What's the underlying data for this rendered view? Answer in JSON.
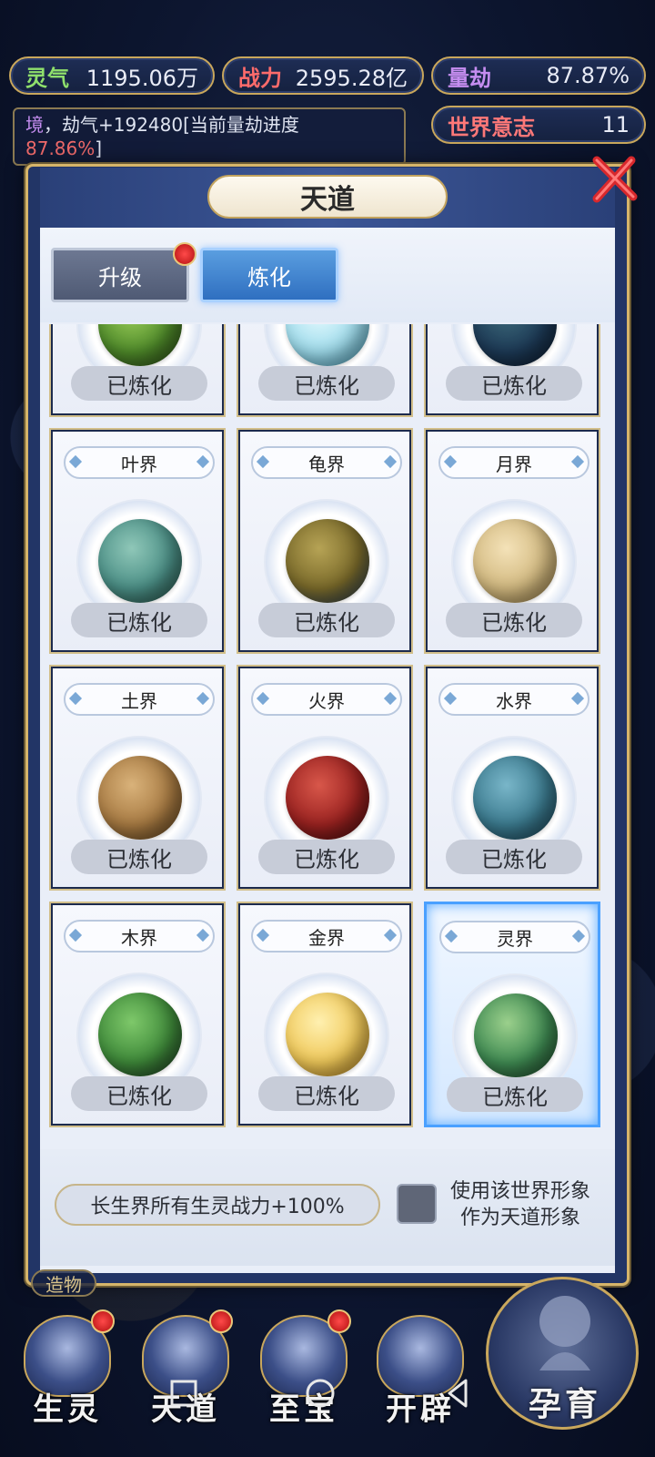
{
  "resources": {
    "lingqi": {
      "label": "灵气",
      "value": "1195.06万"
    },
    "zhanli": {
      "label": "战力",
      "value": "2595.28亿"
    },
    "liangjie": {
      "label": "量劫",
      "value": "87.87%"
    },
    "shijie": {
      "label": "世界意志",
      "value": "11"
    }
  },
  "notice": {
    "prefix": "境",
    "text": "，劫气+192480[当前量劫进度",
    "percent": "87.86%",
    "suffix": "]"
  },
  "dialog": {
    "title": "天道",
    "tabs": [
      {
        "label": "升级",
        "active": false
      },
      {
        "label": "炼化",
        "active": true
      }
    ]
  },
  "worlds": [
    {
      "name": "",
      "status": "已炼化",
      "planet": "green-woven"
    },
    {
      "name": "",
      "status": "已炼化",
      "planet": "ice-crystal"
    },
    {
      "name": "",
      "status": "已炼化",
      "planet": "dark-ocean"
    },
    {
      "name": "叶界",
      "status": "已炼化",
      "planet": "leaf"
    },
    {
      "name": "龟界",
      "status": "已炼化",
      "planet": "turtle"
    },
    {
      "name": "月界",
      "status": "已炼化",
      "planet": "moon"
    },
    {
      "name": "土界",
      "status": "已炼化",
      "planet": "earth"
    },
    {
      "name": "火界",
      "status": "已炼化",
      "planet": "fire"
    },
    {
      "name": "水界",
      "status": "已炼化",
      "planet": "water"
    },
    {
      "name": "木界",
      "status": "已炼化",
      "planet": "wood"
    },
    {
      "name": "金界",
      "status": "已炼化",
      "planet": "gold"
    },
    {
      "name": "灵界",
      "status": "已炼化",
      "planet": "spirit",
      "selected": true
    }
  ],
  "bonus": "长生界所有生灵战力+100%",
  "checkbox_label_line1": "使用该世界形象",
  "checkbox_label_line2": "作为天道形象",
  "nav": {
    "zaowu": "造物",
    "items": [
      "生灵",
      "天道",
      "至宝",
      "开辟"
    ],
    "yunyu": "孕育"
  },
  "colors": {
    "accent_gold": "#c9a75c",
    "selected_blue": "#4aa0ff",
    "badge_red": "#e02020"
  }
}
